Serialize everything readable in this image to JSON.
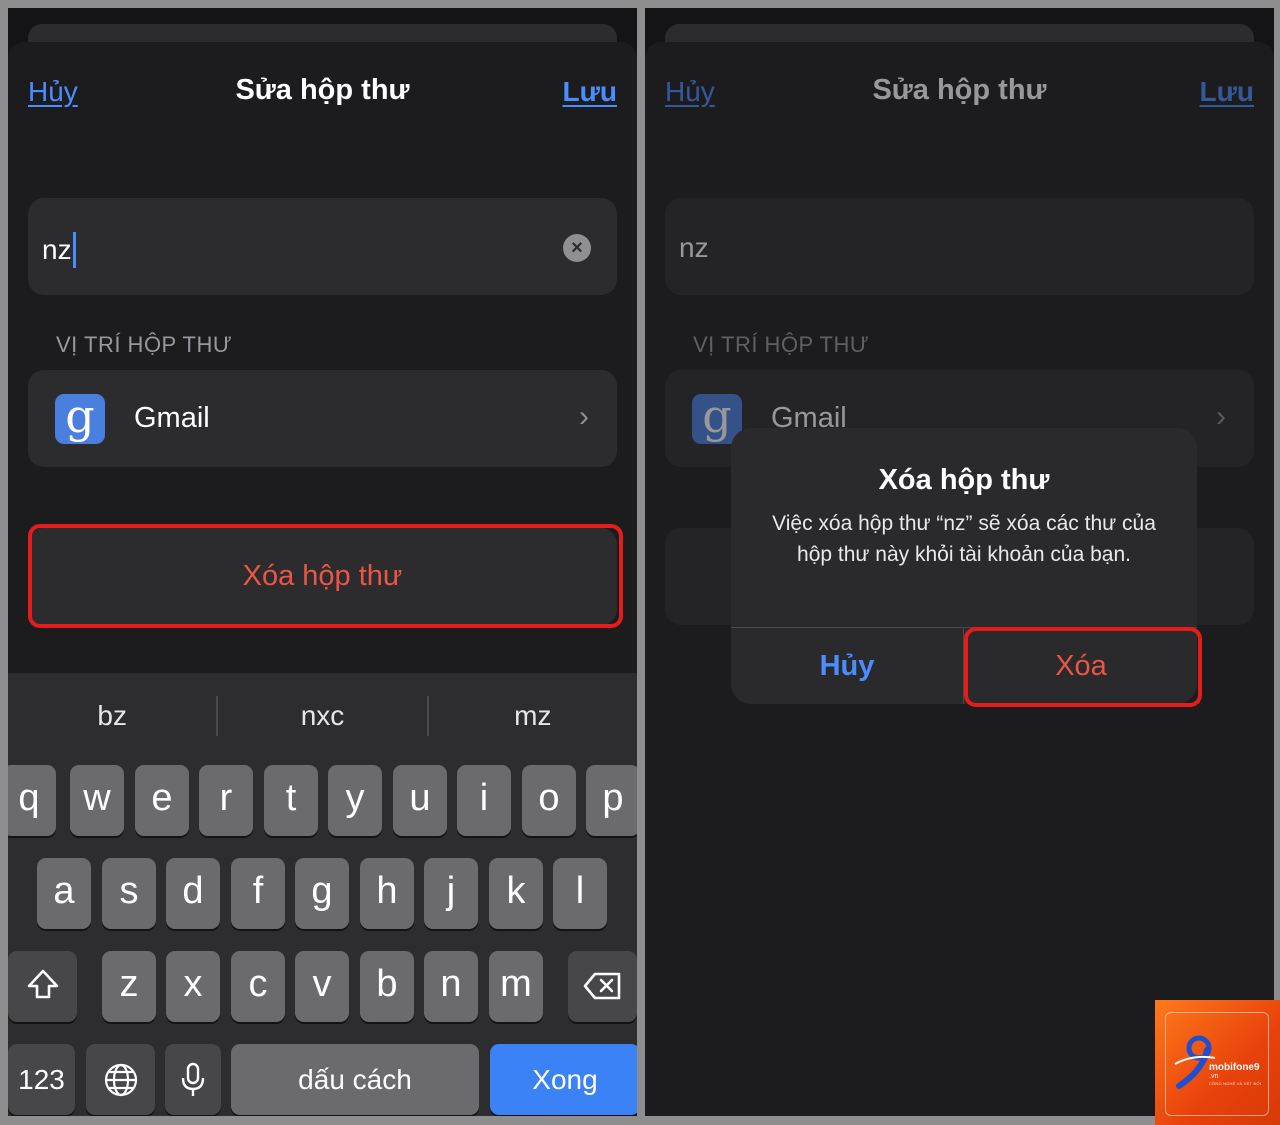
{
  "left": {
    "nav": {
      "cancel": "Hủy",
      "title": "Sửa hộp thư",
      "save": "Lưu"
    },
    "mailbox_name": "nz",
    "section_label": "VỊ TRÍ HỘP THƯ",
    "location": {
      "icon": "google-g-icon",
      "label": "Gmail"
    },
    "delete_button": "Xóa hộp thư",
    "keyboard": {
      "suggestions": [
        "bz",
        "nxc",
        "mz"
      ],
      "row1": [
        "q",
        "w",
        "e",
        "r",
        "t",
        "y",
        "u",
        "i",
        "o",
        "p"
      ],
      "row2": [
        "a",
        "s",
        "d",
        "f",
        "g",
        "h",
        "j",
        "k",
        "l"
      ],
      "row3": [
        "z",
        "x",
        "c",
        "v",
        "b",
        "n",
        "m"
      ],
      "numbers": "123",
      "space": "dấu cách",
      "done": "Xong"
    }
  },
  "right": {
    "nav": {
      "cancel": "Hủy",
      "title": "Sửa hộp thư",
      "save": "Lưu"
    },
    "mailbox_name": "nz",
    "section_label": "VỊ TRÍ HỘP THƯ",
    "location": {
      "label": "Gmail"
    },
    "alert": {
      "title": "Xóa hộp thư",
      "message": "Việc xóa hộp thư “nz” sẽ xóa các thư của hộp thư này khỏi tài khoản của bạn.",
      "cancel": "Hủy",
      "delete": "Xóa"
    }
  },
  "watermark": {
    "brand": "mobifone9",
    "sub": ".vn",
    "tagline": "CÔNG NGHỆ VÀ KẾT NỐI"
  },
  "colors": {
    "accent": "#4a8dff",
    "destructive": "#eb5545",
    "highlight": "#e51c1c",
    "done_key": "#3b82f7"
  }
}
